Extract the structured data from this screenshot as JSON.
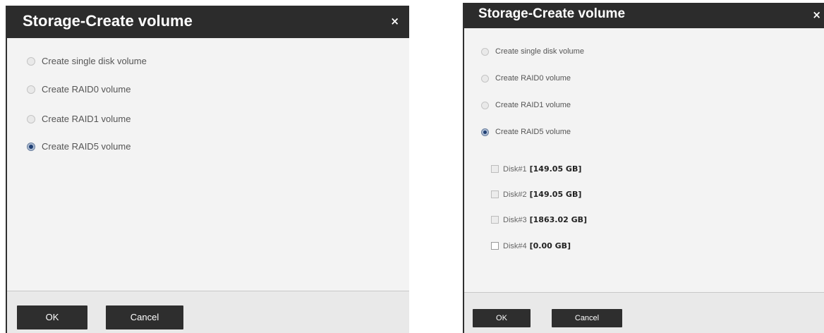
{
  "left_dialog": {
    "title": "Storage-Create volume",
    "close": "×",
    "options": [
      {
        "label": "Create single disk volume",
        "checked": false
      },
      {
        "label": "Create RAID0 volume",
        "checked": false
      },
      {
        "label": "Create RAID1 volume",
        "checked": false
      },
      {
        "label": "Create RAID5 volume",
        "checked": true
      }
    ],
    "ok_label": "OK",
    "cancel_label": "Cancel"
  },
  "right_dialog": {
    "title": "Storage-Create volume",
    "close": "×",
    "options": [
      {
        "label": "Create single disk volume",
        "checked": false
      },
      {
        "label": "Create RAID0 volume",
        "checked": false
      },
      {
        "label": "Create RAID1 volume",
        "checked": false
      },
      {
        "label": "Create RAID5 volume",
        "checked": true
      }
    ],
    "disks": [
      {
        "label": "Disk#1",
        "size": "[149.05 GB]",
        "state": "disabled"
      },
      {
        "label": "Disk#2",
        "size": "[149.05 GB]",
        "state": "disabled"
      },
      {
        "label": "Disk#3",
        "size": "[1863.02 GB]",
        "state": "disabled"
      },
      {
        "label": "Disk#4",
        "size": "[0.00 GB]",
        "state": "enabled"
      }
    ],
    "ok_label": "OK",
    "cancel_label": "Cancel"
  },
  "colors": {
    "titlebar": "#2c2c2c",
    "button": "#2e2e2e",
    "dialog_body": "#f3f3f3",
    "footer": "#e9e9e9",
    "selected_radio": "#1f3f73"
  },
  "icons": {
    "close": "close-icon",
    "radio": "radio-button",
    "checkbox": "checkbox"
  }
}
